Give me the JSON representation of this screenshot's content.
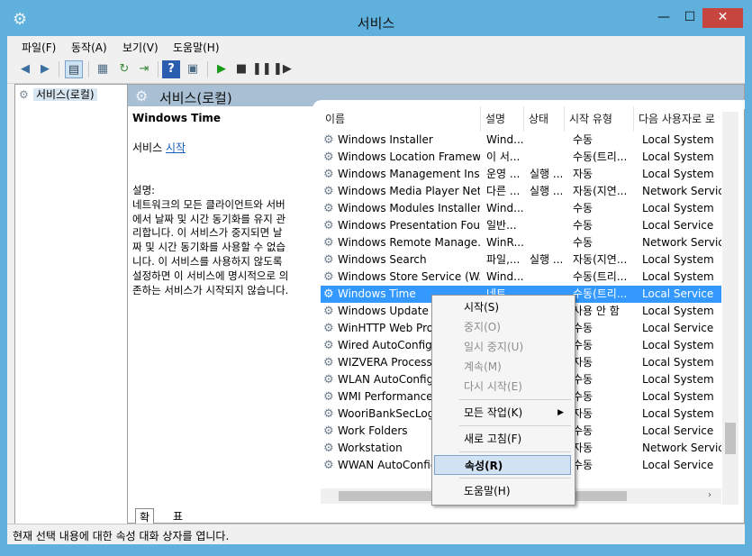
{
  "window": {
    "title": "서비스",
    "min": "—",
    "max": "☐",
    "close": "✕"
  },
  "menu": [
    "파일(F)",
    "동작(A)",
    "보기(V)",
    "도움말(H)"
  ],
  "tree": {
    "root": "서비스(로컬)"
  },
  "panel": {
    "header": "서비스(로컬)",
    "selected_name": "Windows Time",
    "service_prefix": "서비스 ",
    "start_link": "시작",
    "desc_label": "설명:",
    "desc_lines": [
      "네트워크의 모든 클라이언트와 서버",
      "에서 날짜 및 시간 동기화를 유지 관",
      "리합니다. 이 서비스가 중지되면 날",
      "짜 및 시간 동기화를 사용할 수 없습",
      "니다. 이 서비스를 사용하지 않도록",
      "설정하면 이 서비스에 명시적으로 의",
      "존하는 서비스가 시작되지 않습니다."
    ]
  },
  "columns": [
    "이름",
    "설명",
    "상태",
    "시작 유형",
    "다음 사용자로 로"
  ],
  "rows": [
    {
      "name": "Windows Installer",
      "desc": "Wind...",
      "status": "",
      "start": "수동",
      "logon": "Local System"
    },
    {
      "name": "Windows Location Framew...",
      "desc": "이 서...",
      "status": "",
      "start": "수동(트리...",
      "logon": "Local System"
    },
    {
      "name": "Windows Management Inst...",
      "desc": "운영 ...",
      "status": "실행 ...",
      "start": "자동",
      "logon": "Local System"
    },
    {
      "name": "Windows Media Player Net...",
      "desc": "다른 ...",
      "status": "실행 ...",
      "start": "자동(지연...",
      "logon": "Network Service"
    },
    {
      "name": "Windows Modules Installer",
      "desc": "Wind...",
      "status": "",
      "start": "수동",
      "logon": "Local System"
    },
    {
      "name": "Windows Presentation Fou...",
      "desc": "일반...",
      "status": "",
      "start": "수동",
      "logon": "Local Service"
    },
    {
      "name": "Windows Remote Manage...",
      "desc": "WinR...",
      "status": "",
      "start": "수동",
      "logon": "Network Service"
    },
    {
      "name": "Windows Search",
      "desc": "파일,...",
      "status": "실행 ...",
      "start": "자동(지연...",
      "logon": "Local System"
    },
    {
      "name": "Windows Store Service (W...",
      "desc": "Wind...",
      "status": "",
      "start": "수동(트리...",
      "logon": "Local System"
    },
    {
      "name": "Windows Time",
      "desc": "네트",
      "status": "",
      "start": "수동(트리...",
      "logon": "Local Service"
    },
    {
      "name": "Windows Update",
      "desc": "",
      "status": "",
      "start": "사용 안 함",
      "logon": "Local System"
    },
    {
      "name": "WinHTTP Web Prox",
      "desc": "",
      "status": "",
      "start": "수동",
      "logon": "Local Service"
    },
    {
      "name": "Wired AutoConfig",
      "desc": "",
      "status": "",
      "start": "수동",
      "logon": "Local System"
    },
    {
      "name": "WIZVERA Process M",
      "desc": "",
      "status": "",
      "start": "자동",
      "logon": "Local System"
    },
    {
      "name": "WLAN AutoConfig",
      "desc": "",
      "status": "",
      "start": "수동",
      "logon": "Local System"
    },
    {
      "name": "WMI Performance A",
      "desc": "",
      "status": "",
      "start": "수동",
      "logon": "Local System"
    },
    {
      "name": "WooriBankSecLogG",
      "desc": "",
      "status": "",
      "start": "자동",
      "logon": "Local System"
    },
    {
      "name": "Work Folders",
      "desc": "",
      "status": "",
      "start": "수동",
      "logon": "Local Service"
    },
    {
      "name": "Workstation",
      "desc": "",
      "status": "",
      "start": "자동",
      "logon": "Network Service"
    },
    {
      "name": "WWAN AutoConfig",
      "desc": "",
      "status": "",
      "start": "수동",
      "logon": "Local Service"
    }
  ],
  "tabs": [
    "확장",
    "표준"
  ],
  "status": "현재 선택 내용에 대한 속성 대화 상자를 엽니다.",
  "context_menu": [
    {
      "label": "시작(S)",
      "disabled": false
    },
    {
      "label": "중지(O)",
      "disabled": true
    },
    {
      "label": "일시 중지(U)",
      "disabled": true
    },
    {
      "label": "계속(M)",
      "disabled": true
    },
    {
      "label": "다시 시작(E)",
      "disabled": true
    },
    {
      "label": "모든 작업(K)",
      "disabled": false,
      "submenu": true
    },
    {
      "label": "새로 고침(F)",
      "disabled": false
    },
    {
      "label": "속성(R)",
      "disabled": false,
      "bold": true,
      "hover": true
    },
    {
      "label": "도움말(H)",
      "disabled": false
    }
  ],
  "colors": {
    "selection": "#3399ff",
    "frame": "#5fb0dc",
    "close": "#c7453f",
    "link": "#1a5cb8"
  }
}
